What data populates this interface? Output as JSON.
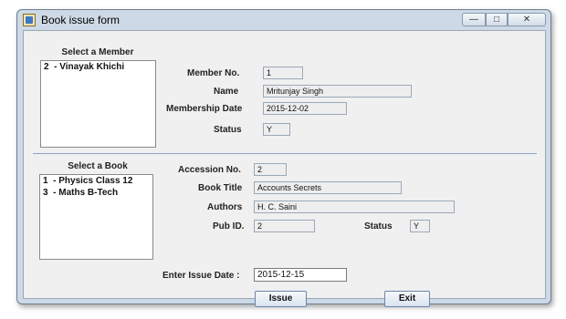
{
  "window": {
    "title": "Book issue form",
    "min_icon": "minimize-icon",
    "max_icon": "maximize-icon",
    "close_icon": "close-icon"
  },
  "member_section": {
    "heading": "Select a Member",
    "list": [
      {
        "id": "2",
        "name": "- Vinayak Khichi"
      }
    ],
    "labels": {
      "member_no": "Member No.",
      "name": "Name",
      "membership_date": "Membership Date",
      "status": "Status"
    },
    "values": {
      "member_no": "1",
      "name": "Mritunjay Singh",
      "membership_date": "2015-12-02",
      "status": "Y"
    }
  },
  "book_section": {
    "heading": "Select a Book",
    "list": [
      {
        "id": "1",
        "name": "- Physics Class 12"
      },
      {
        "id": "3",
        "name": "- Maths B-Tech"
      }
    ],
    "labels": {
      "accession_no": "Accession No.",
      "book_title": "Book Title",
      "authors": "Authors",
      "pub_id": "Pub ID.",
      "status": "Status"
    },
    "values": {
      "accession_no": "2",
      "book_title": "Accounts Secrets",
      "authors": "H. C. Saini",
      "pub_id": "2",
      "status": "Y"
    }
  },
  "issue": {
    "label": "Enter Issue Date :",
    "value": "2015-12-15"
  },
  "buttons": {
    "issue": "Issue",
    "exit": "Exit"
  }
}
